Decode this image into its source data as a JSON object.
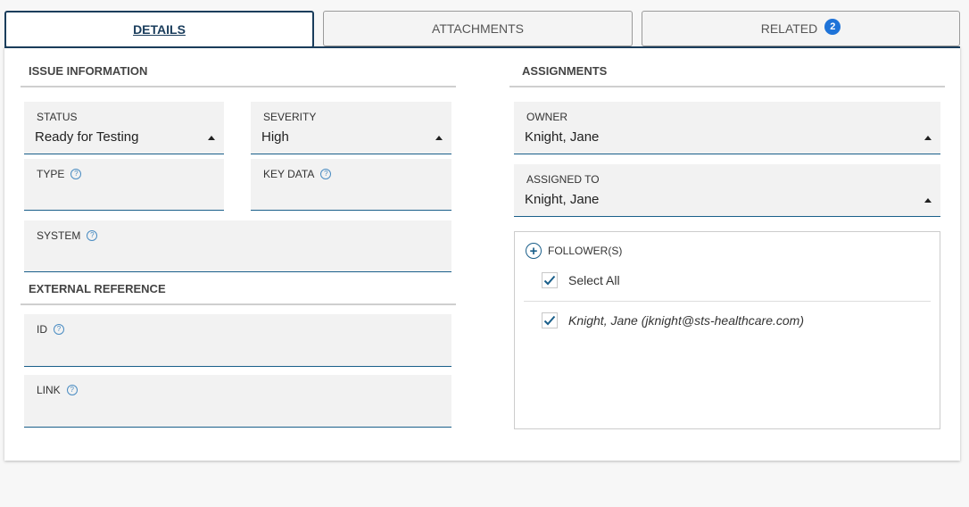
{
  "tabs": {
    "details": "DETAILS",
    "attachments": "ATTACHMENTS",
    "related": "RELATED",
    "related_count": "2"
  },
  "issue_information": {
    "title": "ISSUE INFORMATION",
    "status": {
      "label": "STATUS",
      "value": "Ready for Testing"
    },
    "severity": {
      "label": "SEVERITY",
      "value": "High"
    },
    "type": {
      "label": "TYPE",
      "value": ""
    },
    "key_data": {
      "label": "KEY DATA",
      "value": ""
    },
    "system": {
      "label": "SYSTEM",
      "value": ""
    }
  },
  "external_reference": {
    "title": "EXTERNAL REFERENCE",
    "id": {
      "label": "ID",
      "value": ""
    },
    "link": {
      "label": "LINK",
      "value": ""
    }
  },
  "assignments": {
    "title": "ASSIGNMENTS",
    "owner": {
      "label": "OWNER",
      "value": "Knight, Jane"
    },
    "assigned_to": {
      "label": "ASSIGNED TO",
      "value": "Knight, Jane"
    },
    "followers": {
      "label": "FOLLOWER(S)",
      "select_all": "Select All",
      "items": [
        {
          "name": "Knight, Jane (jknight@sts-healthcare.com)",
          "checked": true
        }
      ]
    }
  },
  "colors": {
    "accent": "#1a3d5c",
    "badge": "#1e73d8",
    "field_underline": "#1a5f8a"
  }
}
